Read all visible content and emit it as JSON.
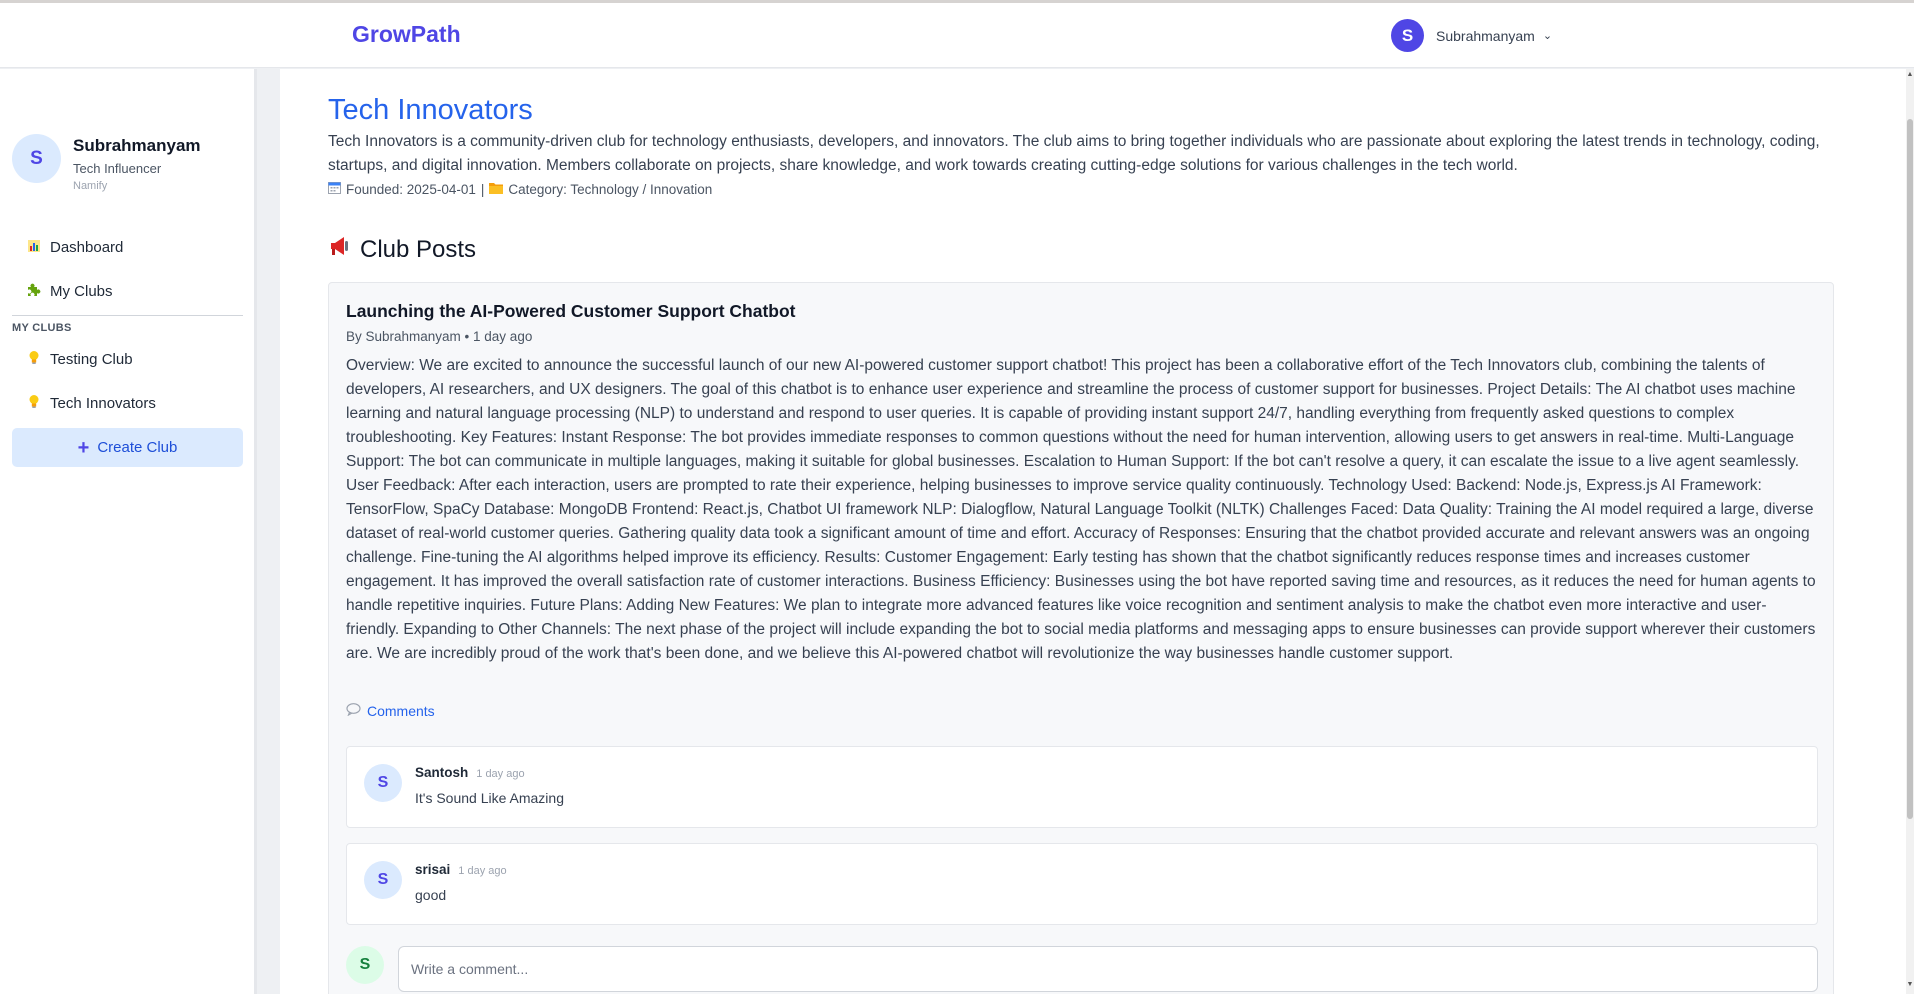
{
  "header": {
    "brand": "GrowPath",
    "user_initial": "S",
    "user_name": "Subrahmanyam"
  },
  "sidebar": {
    "profile": {
      "initial": "S",
      "name": "Subrahmanyam",
      "role": "Tech Influencer",
      "org": "Namify"
    },
    "nav": [
      {
        "label": "Dashboard",
        "icon": "bar-chart-icon"
      },
      {
        "label": "My Clubs",
        "icon": "puzzle-icon"
      }
    ],
    "section_label": "MY CLUBS",
    "clubs": [
      {
        "label": "Testing Club",
        "icon": "lightbulb-icon"
      },
      {
        "label": "Tech Innovators",
        "icon": "lightbulb-icon"
      }
    ],
    "create_label": "Create Club"
  },
  "club": {
    "title": "Tech Innovators",
    "description": "Tech Innovators is a community-driven club for technology enthusiasts, developers, and innovators. The club aims to bring together individuals who are passionate about exploring the latest trends in technology, coding, startups, and digital innovation. Members collaborate on projects, share knowledge, and work towards creating cutting-edge solutions for various challenges in the tech world.",
    "founded": "Founded: 2025-04-01",
    "separator": "|",
    "category": "Category: Technology / Innovation"
  },
  "posts_heading": "Club Posts",
  "post": {
    "title": "Launching the AI-Powered Customer Support Chatbot",
    "byline": "By Subrahmanyam • 1 day ago",
    "body": "Overview: We are excited to announce the successful launch of our new AI-powered customer support chatbot! This project has been a collaborative effort of the Tech Innovators club, combining the talents of developers, AI researchers, and UX designers. The goal of this chatbot is to enhance user experience and streamline the process of customer support for businesses. Project Details: The AI chatbot uses machine learning and natural language processing (NLP) to understand and respond to user queries. It is capable of providing instant support 24/7, handling everything from frequently asked questions to complex troubleshooting. Key Features: Instant Response: The bot provides immediate responses to common questions without the need for human intervention, allowing users to get answers in real-time. Multi-Language Support: The bot can communicate in multiple languages, making it suitable for global businesses. Escalation to Human Support: If the bot can't resolve a query, it can escalate the issue to a live agent seamlessly. User Feedback: After each interaction, users are prompted to rate their experience, helping businesses to improve service quality continuously. Technology Used: Backend: Node.js, Express.js AI Framework: TensorFlow, SpaCy Database: MongoDB Frontend: React.js, Chatbot UI framework NLP: Dialogflow, Natural Language Toolkit (NLTK) Challenges Faced: Data Quality: Training the AI model required a large, diverse dataset of real-world customer queries. Gathering quality data took a significant amount of time and effort. Accuracy of Responses: Ensuring that the chatbot provided accurate and relevant answers was an ongoing challenge. Fine-tuning the AI algorithms helped improve its efficiency. Results: Customer Engagement: Early testing has shown that the chatbot significantly reduces response times and increases customer engagement. It has improved the overall satisfaction rate of customer interactions. Business Efficiency: Businesses using the bot have reported saving time and resources, as it reduces the need for human agents to handle repetitive inquiries. Future Plans: Adding New Features: We plan to integrate more advanced features like voice recognition and sentiment analysis to make the chatbot even more interactive and user-friendly. Expanding to Other Channels: The next phase of the project will include expanding the bot to social media platforms and messaging apps to ensure businesses can provide support wherever their customers are. We are incredibly proud of the work that's been done, and we believe this AI-powered chatbot will revolutionize the way businesses handle customer support.",
    "comments_label": "Comments"
  },
  "comments": [
    {
      "initial": "S",
      "author": "Santosh",
      "time": "1 day ago",
      "text": "It's Sound Like Amazing"
    },
    {
      "initial": "S",
      "author": "srisai",
      "time": "1 day ago",
      "text": "good"
    }
  ],
  "write_comment": {
    "initial": "S",
    "placeholder": "Write a comment..."
  },
  "colors": {
    "brand": "#4f46e5",
    "link": "#2563eb",
    "create_bg": "#dbeafe"
  }
}
